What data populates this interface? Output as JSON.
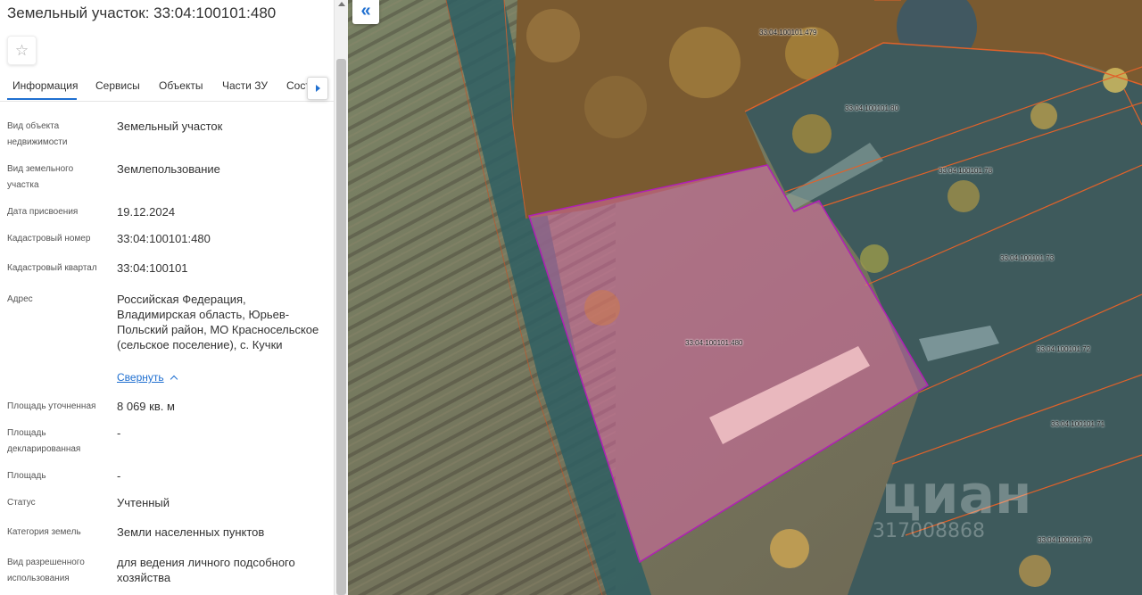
{
  "header": {
    "title": "Земельный участок: 33:04:100101:480"
  },
  "favorite": {
    "icon": "star-icon",
    "glyph": "☆"
  },
  "tabs": [
    {
      "label": "Информация",
      "active": true
    },
    {
      "label": "Сервисы"
    },
    {
      "label": "Объекты"
    },
    {
      "label": "Части ЗУ"
    },
    {
      "label": "Сост"
    }
  ],
  "properties": [
    {
      "label": "Вид объекта недвижимости",
      "value": "Земельный участок"
    },
    {
      "label": "Вид земельного участка",
      "value": "Землепользование"
    },
    {
      "label": "Дата присвоения",
      "value": "19.12.2024"
    },
    {
      "label": "Кадастровый номер",
      "value": "33:04:100101:480"
    },
    {
      "label": "Кадастровый квартал",
      "value": "33:04:100101"
    },
    {
      "label": "Адрес",
      "value": "Российская Федерация, Владимирская область, Юрьев-Польский район, МО Красносельское (сельское поселение), с. Кучки"
    },
    {
      "label": "Площадь уточненная",
      "value": "8 069 кв. м"
    },
    {
      "label": "Площадь декларированная",
      "value": "-"
    },
    {
      "label": "Площадь",
      "value": "-"
    },
    {
      "label": "Статус",
      "value": "Учтенный"
    },
    {
      "label": "Категория земель",
      "value": "Земли населенных пунктов"
    },
    {
      "label": "Вид разрешенного использования",
      "value": "для ведения личного подсобного хозяйства"
    }
  ],
  "collapse_link": "Свернуть",
  "map": {
    "back_button": "«",
    "selected_parcel": "33:04:100101:480",
    "parcels": [
      "33:04:100101:479",
      "33:04:100101:80",
      "33:04:100101:78",
      "33:04:100101:73",
      "33:04:100101:72",
      "33:04:100101:71",
      "33:04:100101:70"
    ],
    "watermark": {
      "brand": "циан",
      "id": "317008868"
    },
    "colors": {
      "selected_fill": "#e86bb0",
      "selected_stroke": "#b01fb5",
      "boundary": "#e0622a",
      "accent": "#1f6fd0"
    }
  }
}
